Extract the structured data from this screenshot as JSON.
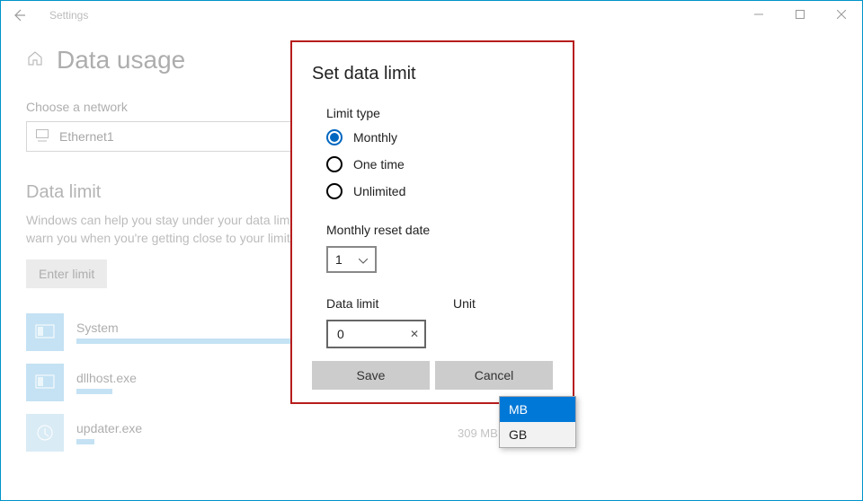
{
  "window": {
    "title": "Settings"
  },
  "page": {
    "title": "Data usage",
    "choose_network_label": "Choose a network",
    "network_name": "Ethernet1",
    "data_limit_heading": "Data limit",
    "help_text": "Windows can help you stay under your data limit. Enter your data limit and we'll warn you when you're getting close to your limit. This won't change your data plan.",
    "enter_limit_btn": "Enter limit",
    "apps": [
      {
        "name": "System",
        "usage": ""
      },
      {
        "name": "dllhost.exe",
        "usage": ""
      },
      {
        "name": "updater.exe",
        "usage": "309 MB"
      }
    ]
  },
  "modal": {
    "title": "Set data limit",
    "limit_type_label": "Limit type",
    "options": {
      "monthly": "Monthly",
      "one_time": "One time",
      "unlimited": "Unlimited"
    },
    "reset_label": "Monthly reset date",
    "reset_value": "1",
    "data_limit_label": "Data limit",
    "data_limit_value": "0",
    "unit_label": "Unit",
    "unit_options": {
      "mb": "MB",
      "gb": "GB"
    },
    "save": "Save",
    "cancel": "Cancel"
  }
}
